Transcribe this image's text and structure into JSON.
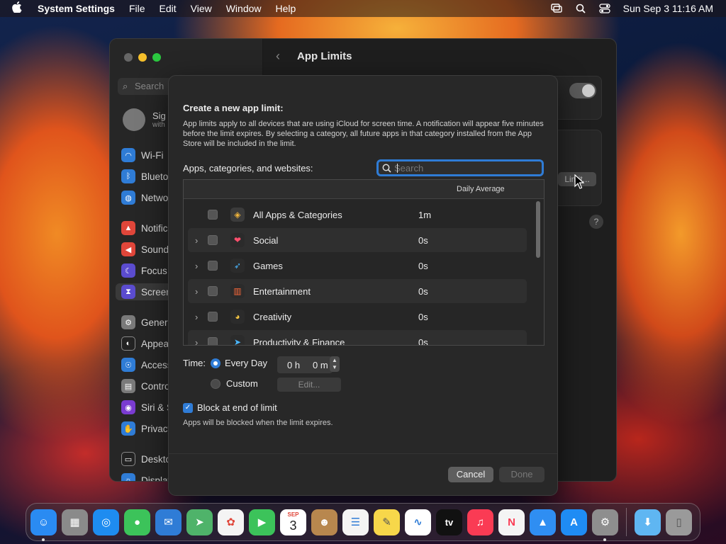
{
  "menubar": {
    "app_name": "System Settings",
    "menus": [
      "File",
      "Edit",
      "View",
      "Window",
      "Help"
    ],
    "datetime": "Sun Sep 3  11:16 AM"
  },
  "settings_window": {
    "title": "App Limits",
    "search_placeholder": "Search",
    "profile": {
      "name": "Sig",
      "sub": "with"
    },
    "sidebar": [
      {
        "label": "Wi-Fi",
        "icon": "wifi-icon",
        "color": "#2f7cd6"
      },
      {
        "label": "Blueto",
        "icon": "bluetooth-icon",
        "color": "#2f7cd6"
      },
      {
        "label": "Netwo",
        "icon": "globe-icon",
        "color": "#2f7cd6"
      },
      {
        "label": "Notific",
        "icon": "bell-icon",
        "color": "#e0463a"
      },
      {
        "label": "Sound",
        "icon": "speaker-icon",
        "color": "#e0463a"
      },
      {
        "label": "Focus",
        "icon": "moon-icon",
        "color": "#5b4ccf"
      },
      {
        "label": "Screen",
        "icon": "hourglass-icon",
        "color": "#5b4ccf"
      },
      {
        "label": "Genera",
        "icon": "gear-icon",
        "color": "#7a7a7a"
      },
      {
        "label": "Appea",
        "icon": "appearance-icon",
        "color": "#222222"
      },
      {
        "label": "Access",
        "icon": "accessibility-icon",
        "color": "#2f7cd6"
      },
      {
        "label": "Contro",
        "icon": "control-center-icon",
        "color": "#7a7a7a"
      },
      {
        "label": "Siri & S",
        "icon": "siri-icon",
        "color": "#7a3bd1"
      },
      {
        "label": "Privacy",
        "icon": "hand-icon",
        "color": "#2f7cd6"
      },
      {
        "label": "Deskto",
        "icon": "desktop-icon",
        "color": "#222222"
      },
      {
        "label": "Display",
        "icon": "display-icon",
        "color": "#2f7cd6"
      }
    ],
    "limits_button": "Limit..."
  },
  "sheet": {
    "title": "Create a new app limit:",
    "description": "App limits apply to all devices that are using iCloud for screen time. A notification will appear five minutes before the limit expires. By selecting a category, all future apps in that category installed from the App Store will be included in the limit.",
    "list_label": "Apps, categories, and websites:",
    "search_placeholder": "Search",
    "column_daily_average": "Daily Average",
    "rows": [
      {
        "label": "All Apps & Categories",
        "avg": "1m",
        "expandable": false,
        "icon": "stack-icon",
        "icon_bg": "#3b3b3b",
        "icon_color": "#f0b43a"
      },
      {
        "label": "Social",
        "avg": "0s",
        "expandable": true,
        "icon": "chat-bubbles-icon",
        "icon_bg": "#2b2b2b",
        "icon_color": "#ff4f6d"
      },
      {
        "label": "Games",
        "avg": "0s",
        "expandable": true,
        "icon": "rocket-icon",
        "icon_bg": "#2b2b2b",
        "icon_color": "#4ab7ff"
      },
      {
        "label": "Entertainment",
        "avg": "0s",
        "expandable": true,
        "icon": "popcorn-icon",
        "icon_bg": "#2b2b2b",
        "icon_color": "#ff6a3a"
      },
      {
        "label": "Creativity",
        "avg": "0s",
        "expandable": true,
        "icon": "palette-icon",
        "icon_bg": "#2b2b2b",
        "icon_color": "#f5c542"
      },
      {
        "label": "Productivity & Finance",
        "avg": "0s",
        "expandable": true,
        "icon": "paper-plane-icon",
        "icon_bg": "#2b2b2b",
        "icon_color": "#4ab7ff"
      }
    ],
    "time_label": "Time:",
    "every_day": "Every Day",
    "hours": "0 h",
    "minutes": "0 m",
    "custom": "Custom",
    "edit_button": "Edit...",
    "block_label": "Block at end of limit",
    "block_note": "Apps will be blocked when the limit expires.",
    "cancel_button": "Cancel",
    "done_button": "Done"
  },
  "dock": {
    "apps": [
      {
        "name": "finder",
        "bg": "#2a8bf2",
        "glyph": "☺"
      },
      {
        "name": "launchpad",
        "bg": "#8a8a8a",
        "glyph": "▦"
      },
      {
        "name": "safari",
        "bg": "#1e8cf0",
        "glyph": "◎"
      },
      {
        "name": "messages",
        "bg": "#3cc35a",
        "glyph": "●"
      },
      {
        "name": "mail",
        "bg": "#2f7cd6",
        "glyph": "✉"
      },
      {
        "name": "maps",
        "bg": "#4fb36a",
        "glyph": "➤"
      },
      {
        "name": "photos",
        "bg": "#f4f4f4",
        "glyph": "✿"
      },
      {
        "name": "facetime",
        "bg": "#3cc35a",
        "glyph": "▶"
      },
      {
        "name": "calendar",
        "bg": "#ffffff",
        "glyph": "3"
      },
      {
        "name": "contacts",
        "bg": "#b8874e",
        "glyph": "☻"
      },
      {
        "name": "reminders",
        "bg": "#f4f4f4",
        "glyph": "☰"
      },
      {
        "name": "notes",
        "bg": "#f7d74a",
        "glyph": "✎"
      },
      {
        "name": "freeform",
        "bg": "#ffffff",
        "glyph": "∿"
      },
      {
        "name": "apple-tv",
        "bg": "#111111",
        "glyph": "tv"
      },
      {
        "name": "music",
        "bg": "#fa3b54",
        "glyph": "♫"
      },
      {
        "name": "news",
        "bg": "#f4f4f4",
        "glyph": "N"
      },
      {
        "name": "keynote",
        "bg": "#2f8ef2",
        "glyph": "▲"
      },
      {
        "name": "app-store",
        "bg": "#1f8cf4",
        "glyph": "A"
      },
      {
        "name": "system-settings",
        "bg": "#8e8e8e",
        "glyph": "⚙"
      },
      {
        "name": "downloads",
        "bg": "#5fb6f2",
        "glyph": "⬇"
      },
      {
        "name": "trash",
        "bg": "#9a9a9a",
        "glyph": "🗑"
      }
    ],
    "calendar_month": "SEP",
    "calendar_day": "3"
  }
}
